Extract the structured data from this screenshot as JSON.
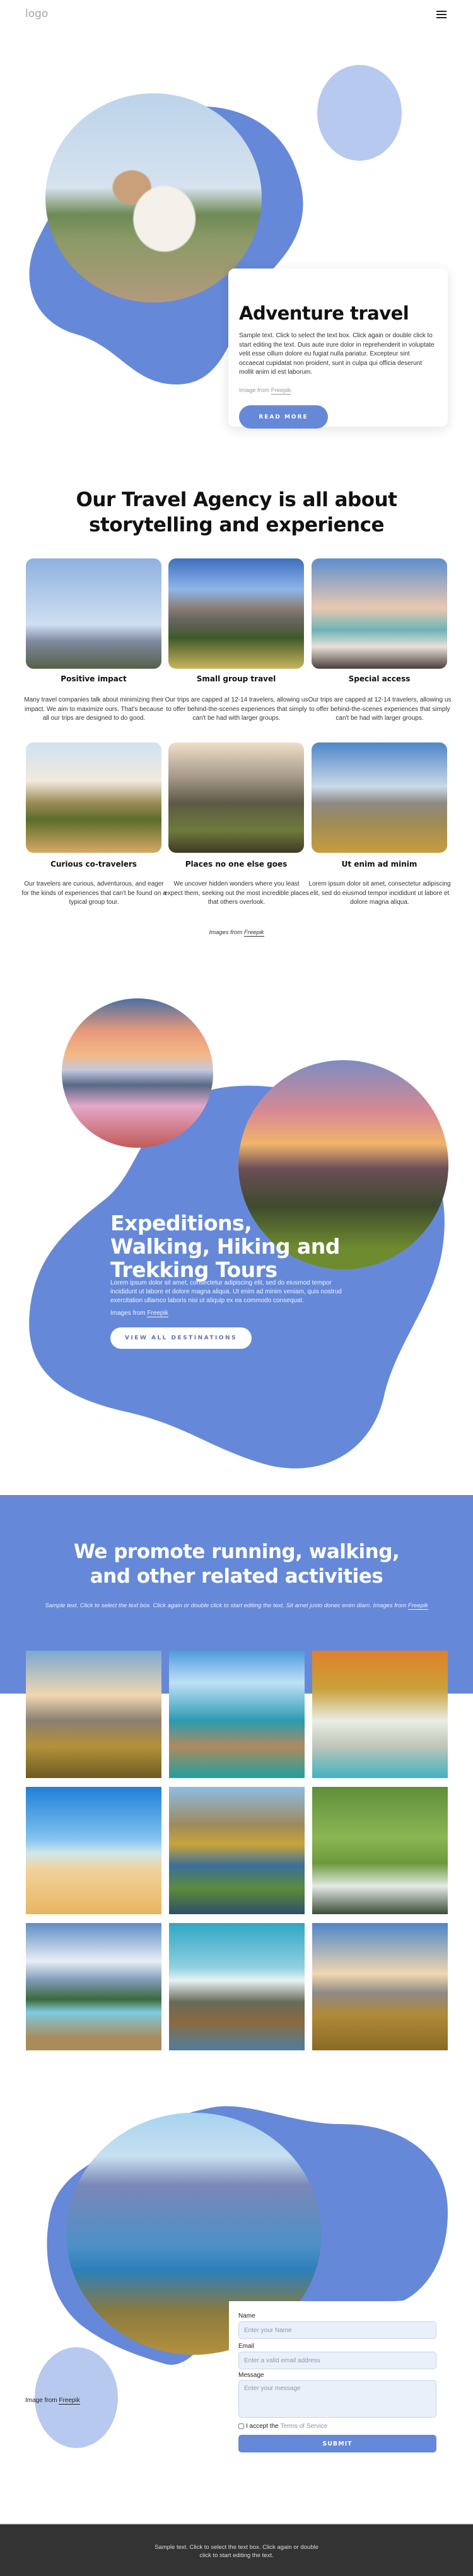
{
  "header": {
    "logo": "logo",
    "menu_icon": "hamburger-icon"
  },
  "colors": {
    "accent": "#6589d8",
    "accent_light": "#b8c9ef",
    "footer_bg": "#333333"
  },
  "hero": {
    "title": "Adventure travel",
    "text": "Sample text. Click to select the text box. Click again or double click to start editing the text. Duis aute irure dolor in reprehenderit in voluptate velit esse cillum dolore eu fugiat nulla pariatur. Excepteur sint occaecat cupidatat non proident, sunt in culpa qui officia deserunt mollit anim id est laborum.",
    "credit_prefix": "Image from",
    "credit_link": "Freepik",
    "button": "READ MORE"
  },
  "features": {
    "title_line1": "Our Travel Agency is all about",
    "title_line2": "storytelling and experience",
    "items": [
      {
        "title": "Positive impact",
        "text": "Many travel companies talk about minimizing their impact. We aim to maximize ours. That's because all our trips are designed to do good."
      },
      {
        "title": "Small group travel",
        "text": "Our trips are capped at 12-14 travelers, allowing us to offer behind-the-scenes experiences that simply can't be had with larger groups."
      },
      {
        "title": "Special access",
        "text": "Our trips are capped at 12-14 travelers, allowing us to offer behind-the-scenes experiences that simply can't be had with larger groups."
      },
      {
        "title": "Curious co-travelers",
        "text": "Our travelers are curious, adventurous, and eager for the kinds of experiences that can't be found on a typical group tour."
      },
      {
        "title": "Places no one else goes",
        "text": "We uncover hidden wonders where you least expect them, seeking out the most incredible places that others overlook."
      },
      {
        "title": "Ut enim ad minim",
        "text": "Lorem ipsum dolor sit amet, consectetur adipiscing elit, sed do eiusmod tempor incididunt ut labore et dolore magna aliqua."
      }
    ],
    "credit_prefix": "Images from",
    "credit_link": "Freepik"
  },
  "expeditions": {
    "title_line1": "Expeditions,",
    "title_line2": "Walking, Hiking and",
    "title_line3": "Trekking Tours",
    "text": "Lorem ipsum dolor sit amet, consectetur adipiscing elit, sed do eiusmod tempor incididunt ut labore et dolore magna aliqua. Ut enim ad minim veniam, quis nostrud exercitation ullamco laboris nisi ut aliquip ex ea commodo consequat.",
    "credit_prefix": "Images from",
    "credit_link": "Freepik",
    "button": "VIEW ALL DESTINATIONS"
  },
  "promote": {
    "title_line1": "We promote running, walking,",
    "title_line2": "and other related activities",
    "subtitle": "Sample text. Click to select the text box. Click again or double click to start editing the text. Sit amet justo donec enim diam. Images from",
    "credit_link": "Freepik",
    "gallery_count": 9
  },
  "contact": {
    "credit_prefix": "Image from",
    "credit_link": "Freepik",
    "form": {
      "name_label": "Name",
      "name_placeholder": "Enter your Name",
      "email_label": "Email",
      "email_placeholder": "Enter a valid email address",
      "message_label": "Message",
      "message_placeholder": "Enter your message",
      "terms_prefix": "I accept the",
      "terms_link": "Terms of Service",
      "submit": "SUBMIT"
    }
  },
  "footer": {
    "line1": "Sample text. Click to select the text box. Click again or double",
    "line2": "click to start editing the text."
  }
}
